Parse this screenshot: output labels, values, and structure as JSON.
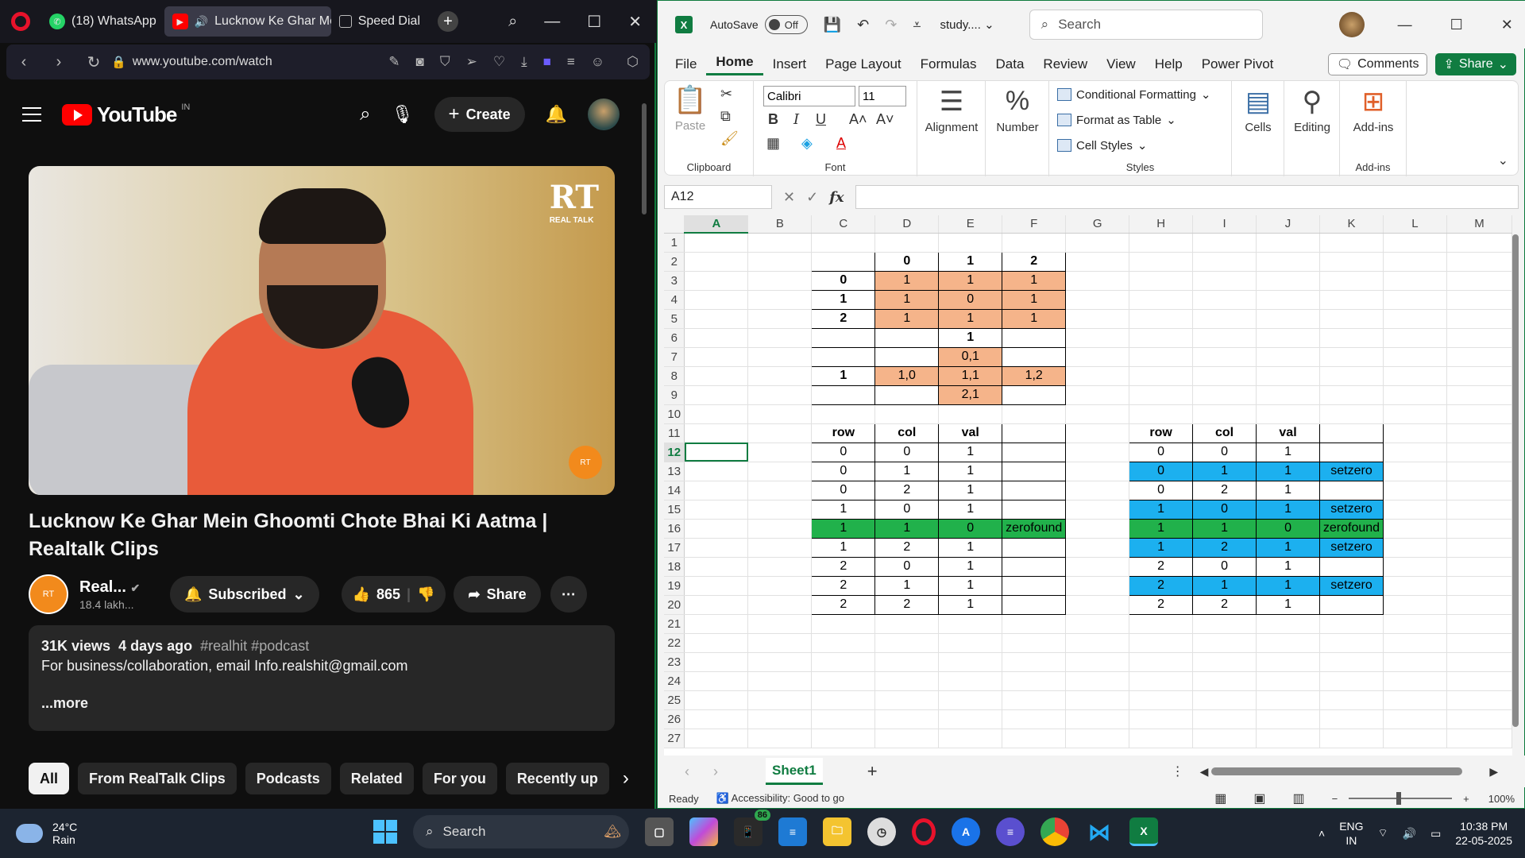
{
  "opera": {
    "tabs": [
      {
        "label": "(18) WhatsApp",
        "icon": "whatsapp-icon"
      },
      {
        "label": "Lucknow Ke Ghar Mein",
        "icon": "youtube-icon",
        "active": true
      },
      {
        "label": "Speed Dial",
        "icon": "speed-dial-icon"
      }
    ],
    "url": "www.youtube.com/watch"
  },
  "youtube": {
    "logo_text": "YouTube",
    "region": "IN",
    "create_label": "Create",
    "video_watermark": "RT",
    "video_watermark_sub": "REAL TALK",
    "badge_text": "RT",
    "title": "Lucknow Ke Ghar Mein Ghoomti Chote Bhai Ki Aatma | Realtalk Clips",
    "channel_name": "Real...",
    "channel_subs": "18.4 lakh...",
    "subscribed_label": "Subscribed",
    "likes": "865",
    "share_label": "Share",
    "views": "31K views",
    "age": "4 days ago",
    "tags": "#realhit #podcast",
    "description": "For business/collaboration, email Info.realshit@gmail.com",
    "more_label": "...more",
    "chips": [
      "All",
      "From RealTalk Clips",
      "Podcasts",
      "Related",
      "For you",
      "Recently up"
    ]
  },
  "excel": {
    "autosave_label": "AutoSave",
    "autosave_state": "Off",
    "filename": "study....",
    "search_placeholder": "Search",
    "menu": [
      "File",
      "Home",
      "Insert",
      "Page Layout",
      "Formulas",
      "Data",
      "Review",
      "View",
      "Help",
      "Power Pivot"
    ],
    "comments_label": "Comments",
    "share_label": "Share",
    "ribbon": {
      "paste": "Paste",
      "clipboard": "Clipboard",
      "font_name": "Calibri",
      "font_size": "11",
      "font": "Font",
      "alignment": "Alignment",
      "number": "Number",
      "conditional": "Conditional Formatting",
      "format_table": "Format as Table",
      "cell_styles": "Cell Styles",
      "styles": "Styles",
      "cells": "Cells",
      "editing": "Editing",
      "addins": "Add-ins",
      "addins_group": "Add-ins"
    },
    "namebox": "A12",
    "columns": [
      "A",
      "B",
      "C",
      "D",
      "E",
      "F",
      "G",
      "H",
      "I",
      "J",
      "K",
      "L",
      "M"
    ],
    "rows": [
      {
        "n": "1",
        "c": [
          "",
          "",
          "",
          "",
          "",
          "",
          "",
          "",
          "",
          "",
          "",
          "",
          ""
        ]
      },
      {
        "n": "2",
        "c": [
          "",
          "",
          "",
          "0",
          "1",
          "2",
          "",
          "",
          "",
          "",
          "",
          "",
          ""
        ]
      },
      {
        "n": "3",
        "c": [
          "",
          "",
          "0",
          "1",
          "1",
          "1",
          "",
          "",
          "",
          "",
          "",
          "",
          ""
        ]
      },
      {
        "n": "4",
        "c": [
          "",
          "",
          "1",
          "1",
          "0",
          "1",
          "",
          "",
          "",
          "",
          "",
          "",
          ""
        ]
      },
      {
        "n": "5",
        "c": [
          "",
          "",
          "2",
          "1",
          "1",
          "1",
          "",
          "",
          "",
          "",
          "",
          "",
          ""
        ]
      },
      {
        "n": "6",
        "c": [
          "",
          "",
          "",
          "",
          "1",
          "",
          "",
          "",
          "",
          "",
          "",
          "",
          ""
        ]
      },
      {
        "n": "7",
        "c": [
          "",
          "",
          "",
          "",
          "0,1",
          "",
          "",
          "",
          "",
          "",
          "",
          "",
          ""
        ]
      },
      {
        "n": "8",
        "c": [
          "",
          "",
          "1",
          "1,0",
          "1,1",
          "1,2",
          "",
          "",
          "",
          "",
          "",
          "",
          ""
        ]
      },
      {
        "n": "9",
        "c": [
          "",
          "",
          "",
          "",
          "2,1",
          "",
          "",
          "",
          "",
          "",
          "",
          "",
          ""
        ]
      },
      {
        "n": "10",
        "c": [
          "",
          "",
          "",
          "",
          "",
          "",
          "",
          "",
          "",
          "",
          "",
          "",
          ""
        ]
      },
      {
        "n": "11",
        "c": [
          "",
          "",
          "row",
          "col",
          "val",
          "",
          "",
          "row",
          "col",
          "val",
          "",
          "",
          ""
        ]
      },
      {
        "n": "12",
        "c": [
          "",
          "",
          "0",
          "0",
          "1",
          "",
          "",
          "0",
          "0",
          "1",
          "",
          "",
          ""
        ]
      },
      {
        "n": "13",
        "c": [
          "",
          "",
          "0",
          "1",
          "1",
          "",
          "",
          "0",
          "1",
          "1",
          "setzero",
          "",
          ""
        ]
      },
      {
        "n": "14",
        "c": [
          "",
          "",
          "0",
          "2",
          "1",
          "",
          "",
          "0",
          "2",
          "1",
          "",
          "",
          ""
        ]
      },
      {
        "n": "15",
        "c": [
          "",
          "",
          "1",
          "0",
          "1",
          "",
          "",
          "1",
          "0",
          "1",
          "setzero",
          "",
          ""
        ]
      },
      {
        "n": "16",
        "c": [
          "",
          "",
          "1",
          "1",
          "0",
          "zerofound",
          "",
          "1",
          "1",
          "0",
          "zerofound",
          "",
          ""
        ]
      },
      {
        "n": "17",
        "c": [
          "",
          "",
          "1",
          "2",
          "1",
          "",
          "",
          "1",
          "2",
          "1",
          "setzero",
          "",
          ""
        ]
      },
      {
        "n": "18",
        "c": [
          "",
          "",
          "2",
          "0",
          "1",
          "",
          "",
          "2",
          "0",
          "1",
          "",
          "",
          ""
        ]
      },
      {
        "n": "19",
        "c": [
          "",
          "",
          "2",
          "1",
          "1",
          "",
          "",
          "2",
          "1",
          "1",
          "setzero",
          "",
          ""
        ]
      },
      {
        "n": "20",
        "c": [
          "",
          "",
          "2",
          "2",
          "1",
          "",
          "",
          "2",
          "2",
          "1",
          "",
          "",
          ""
        ]
      },
      {
        "n": "21",
        "c": [
          "",
          "",
          "",
          "",
          "",
          "",
          "",
          "",
          "",
          "",
          "",
          "",
          ""
        ]
      },
      {
        "n": "22",
        "c": [
          "",
          "",
          "",
          "",
          "",
          "",
          "",
          "",
          "",
          "",
          "",
          "",
          ""
        ]
      },
      {
        "n": "23",
        "c": [
          "",
          "",
          "",
          "",
          "",
          "",
          "",
          "",
          "",
          "",
          "",
          "",
          ""
        ]
      },
      {
        "n": "24",
        "c": [
          "",
          "",
          "",
          "",
          "",
          "",
          "",
          "",
          "",
          "",
          "",
          "",
          ""
        ]
      },
      {
        "n": "25",
        "c": [
          "",
          "",
          "",
          "",
          "",
          "",
          "",
          "",
          "",
          "",
          "",
          "",
          ""
        ]
      },
      {
        "n": "26",
        "c": [
          "",
          "",
          "",
          "",
          "",
          "",
          "",
          "",
          "",
          "",
          "",
          "",
          ""
        ]
      },
      {
        "n": "27",
        "c": [
          "",
          "",
          "",
          "",
          "",
          "",
          "",
          "",
          "",
          "",
          "",
          "",
          ""
        ]
      }
    ],
    "sheet_tab": "Sheet1",
    "status_ready": "Ready",
    "status_access": "Accessibility: Good to go",
    "zoom": "100%",
    "colors": {
      "peach": "#f5b48a",
      "green": "#21b14b",
      "blue": "#1cb0ef",
      "accent": "#107c41"
    }
  },
  "taskbar": {
    "temp": "24°C",
    "weather": "Rain",
    "search_label": "Search",
    "badge": "86",
    "lang1": "ENG",
    "lang2": "IN",
    "time": "10:38 PM",
    "date": "22-05-2025"
  }
}
